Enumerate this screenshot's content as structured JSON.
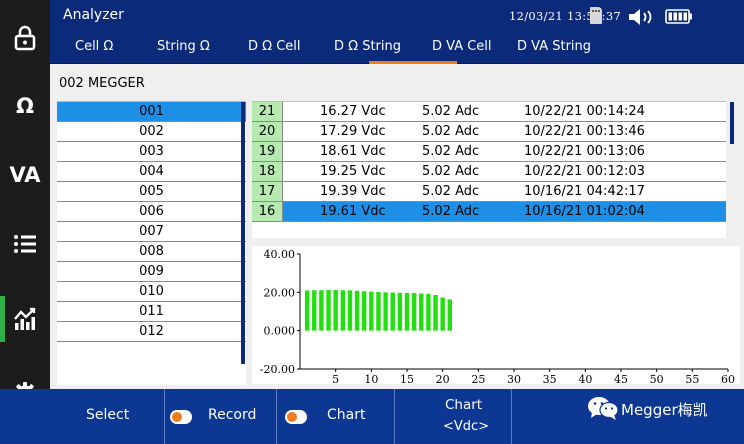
{
  "header": {
    "title": "Analyzer",
    "datetime": "12/03/21  13:53:37"
  },
  "tabs": [
    {
      "label": "Cell Ω"
    },
    {
      "label": "String Ω"
    },
    {
      "label": "D Ω Cell"
    },
    {
      "label": "D Ω String"
    },
    {
      "label": "D VA Cell",
      "active": true
    },
    {
      "label": "D VA String"
    }
  ],
  "sidebar": {
    "omega_label": "Ω",
    "va_label": "VA",
    "active_item": "chart"
  },
  "group_name": "002 MEGGER",
  "cells": [
    "001",
    "002",
    "003",
    "004",
    "005",
    "006",
    "007",
    "008",
    "009",
    "010",
    "011",
    "012"
  ],
  "selected_cell": "001",
  "readings": [
    {
      "index": "21",
      "voltage": "16.27 Vdc",
      "current": "5.02  Adc",
      "timestamp": "10/22/21 00:14:24"
    },
    {
      "index": "20",
      "voltage": "17.29 Vdc",
      "current": "5.02  Adc",
      "timestamp": "10/22/21 00:13:46"
    },
    {
      "index": "19",
      "voltage": "18.61 Vdc",
      "current": "5.02  Adc",
      "timestamp": "10/22/21 00:13:06"
    },
    {
      "index": "18",
      "voltage": "19.25 Vdc",
      "current": "5.02  Adc",
      "timestamp": "10/22/21 00:12:03"
    },
    {
      "index": "17",
      "voltage": "19.39 Vdc",
      "current": "5.02  Adc",
      "timestamp": "10/16/21 04:42:17"
    },
    {
      "index": "16",
      "voltage": "19.61 Vdc",
      "current": "5.02  Adc",
      "timestamp": "10/16/21 01:02:04",
      "selected": true
    }
  ],
  "chart_data": {
    "type": "bar",
    "bar_color": "#22e010",
    "x": [
      1,
      2,
      3,
      4,
      5,
      6,
      7,
      8,
      9,
      10,
      11,
      12,
      13,
      14,
      15,
      16,
      17,
      18,
      19,
      20,
      21
    ],
    "values": [
      21.0,
      21.1,
      21.1,
      21.2,
      21.2,
      21.1,
      21.0,
      20.8,
      20.6,
      20.4,
      20.2,
      20.0,
      19.9,
      19.8,
      19.7,
      19.61,
      19.39,
      19.25,
      18.61,
      17.29,
      16.27
    ],
    "ylim": [
      -20,
      40
    ],
    "yticks": [
      "40.00",
      "20.00",
      "0.000",
      "-20.00"
    ],
    "yticks_values": [
      40,
      20,
      0,
      -20
    ],
    "xticks": [
      5,
      10,
      15,
      20,
      25,
      30,
      35,
      40,
      45,
      50,
      55,
      60
    ],
    "xlim": [
      0,
      60
    ],
    "grid": false
  },
  "footer": {
    "select_label": "Select",
    "record_label": "Record",
    "chart_label": "Chart",
    "chart_unit_title": "Chart",
    "chart_unit_value": "<Vdc>",
    "brand": "Megger梅凯"
  }
}
